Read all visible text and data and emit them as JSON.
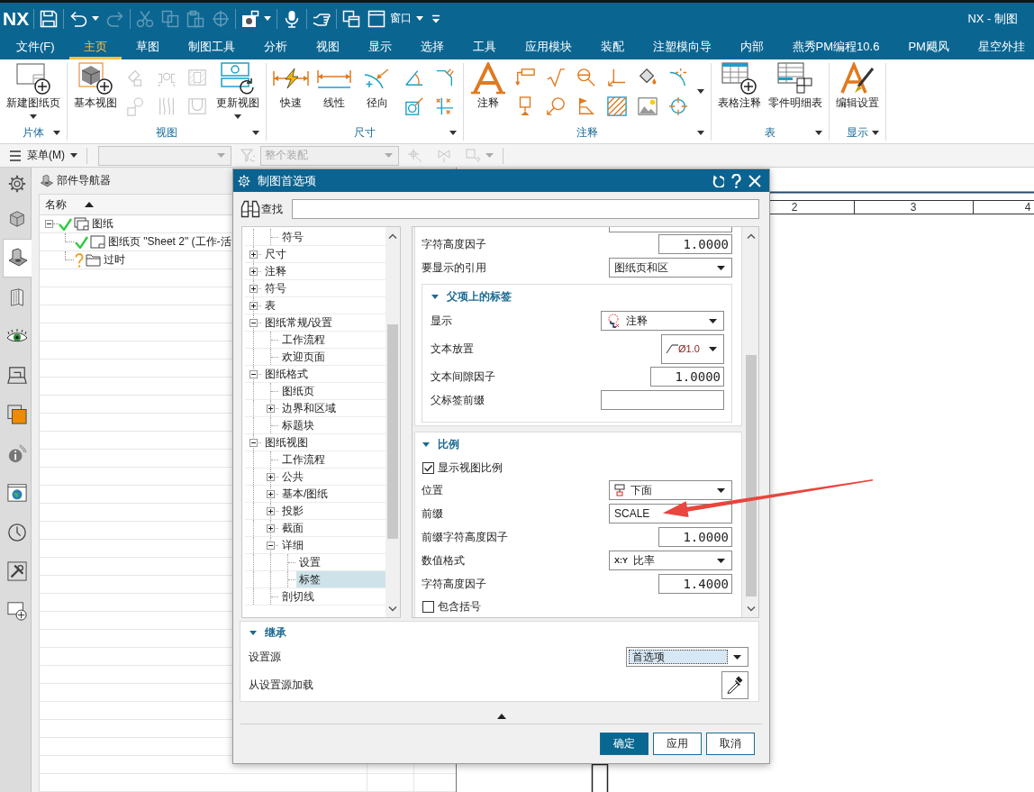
{
  "window": {
    "logo": "NX",
    "title": "NX - 制图"
  },
  "quick_access": [
    {
      "items": [
        {
          "kind": "save",
          "disabled": false,
          "has_menu": false
        }
      ]
    },
    {
      "items": [
        {
          "kind": "undo",
          "disabled": false,
          "has_menu": true
        },
        {
          "kind": "redo",
          "disabled": true,
          "has_menu": false
        }
      ]
    },
    {
      "items": [
        {
          "kind": "cut",
          "disabled": true,
          "has_menu": false
        },
        {
          "kind": "copy",
          "disabled": true,
          "has_menu": false
        },
        {
          "kind": "paste",
          "disabled": true,
          "has_menu": false
        },
        {
          "kind": "move",
          "disabled": true,
          "has_menu": false
        }
      ]
    },
    {
      "items": [
        {
          "kind": "camera",
          "disabled": false,
          "has_menu": true
        }
      ]
    },
    {
      "items": [
        {
          "kind": "microphone",
          "disabled": false,
          "has_menu": false
        }
      ]
    },
    {
      "items": [
        {
          "kind": "hand",
          "disabled": false,
          "has_menu": false
        }
      ]
    },
    {
      "items": [
        {
          "kind": "windows",
          "disabled": false,
          "has_menu": false
        },
        {
          "kind": "window",
          "label": "窗口",
          "disabled": false,
          "has_menu": true
        },
        {
          "kind": "customize",
          "disabled": false,
          "has_menu": false
        }
      ]
    }
  ],
  "menu_tabs": [
    {
      "label": "文件(F)",
      "selected": false
    },
    {
      "label": "主页",
      "selected": true
    },
    {
      "label": "草图",
      "selected": false
    },
    {
      "label": "制图工具",
      "selected": false
    },
    {
      "label": "分析",
      "selected": false
    },
    {
      "label": "视图",
      "selected": false
    },
    {
      "label": "显示",
      "selected": false
    },
    {
      "label": "选择",
      "selected": false
    },
    {
      "label": "工具",
      "selected": false
    },
    {
      "label": "应用模块",
      "selected": false
    },
    {
      "label": "装配",
      "selected": false
    },
    {
      "label": "注塑模向导",
      "selected": false
    },
    {
      "label": "内部",
      "selected": false
    },
    {
      "label": "燕秀PM编程10.6",
      "selected": false
    },
    {
      "label": "PM飓风",
      "selected": false
    },
    {
      "label": "星空外挂",
      "selected": false
    }
  ],
  "ribbon": {
    "groups": [
      {
        "label": "片体",
        "has_menu": true,
        "tools": [
          {
            "kind": "new_sheet",
            "label": "新建图纸页",
            "has_menu": true,
            "disabled": false
          }
        ]
      },
      {
        "label": "视图",
        "has_menu": true,
        "tools": [
          {
            "kind": "base_view",
            "label": "基本视图",
            "has_menu": false,
            "disabled": false
          },
          {
            "stack": [
              {
                "kind": "projected_view",
                "disabled": true
              },
              {
                "kind": "detail_view",
                "disabled": true
              }
            ]
          },
          {
            "stack": [
              {
                "kind": "section_view",
                "disabled": true
              },
              {
                "kind": "broken_view",
                "disabled": true
              }
            ]
          },
          {
            "stack": [
              {
                "kind": "view_break",
                "disabled": true
              },
              {
                "kind": "local_section",
                "disabled": true
              }
            ]
          },
          {
            "kind": "update_view",
            "label": "更新视图",
            "has_menu": true,
            "disabled": false
          }
        ]
      },
      {
        "label": "尺寸",
        "has_menu": true,
        "tools": [
          {
            "kind": "quick_dim",
            "label": "快速",
            "has_menu": false,
            "disabled": false
          },
          {
            "kind": "linear_dim",
            "label": "线性",
            "has_menu": false,
            "disabled": false
          },
          {
            "kind": "radial_dim",
            "label": "径向",
            "has_menu": false,
            "disabled": false
          },
          {
            "stack": [
              {
                "kind": "angular_dim",
                "disabled": false
              },
              {
                "kind": "hole_dim",
                "disabled": false
              }
            ]
          },
          {
            "stack": [
              {
                "kind": "chamfer_dim",
                "disabled": false
              },
              {
                "kind": "ordinate_dim",
                "disabled": false
              }
            ]
          }
        ]
      },
      {
        "label": "注释",
        "has_menu": true,
        "tools": [
          {
            "kind": "note",
            "label": "注释",
            "has_menu": false,
            "disabled": false
          },
          {
            "stack": [
              {
                "kind": "feature_frame",
                "disabled": false
              },
              {
                "kind": "datum",
                "disabled": false
              }
            ]
          },
          {
            "stack": [
              {
                "kind": "surface_finish",
                "disabled": false
              },
              {
                "kind": "balloon",
                "disabled": false
              }
            ]
          },
          {
            "stack": [
              {
                "kind": "weld",
                "disabled": false
              },
              {
                "kind": "flag",
                "disabled": false
              }
            ]
          },
          {
            "stack": [
              {
                "kind": "leader_corner",
                "disabled": false
              },
              {
                "kind": "hatch",
                "disabled": false
              }
            ]
          },
          {
            "stack": [
              {
                "kind": "area_fill",
                "disabled": false
              },
              {
                "kind": "image",
                "disabled": false
              }
            ]
          },
          {
            "stack": [
              {
                "kind": "center_mark",
                "disabled": false
              },
              {
                "kind": "bolt_circle",
                "disabled": false
              }
            ]
          },
          {
            "kind": "more"
          }
        ]
      },
      {
        "label": "表",
        "has_menu": true,
        "tools": [
          {
            "kind": "table_note",
            "label": "表格注释",
            "has_menu": false,
            "disabled": false
          },
          {
            "kind": "parts_list",
            "label": "零件明细表",
            "has_menu": false,
            "disabled": false
          }
        ]
      },
      {
        "label": "显示",
        "has_menu": true,
        "tools": [
          {
            "kind": "edit_settings",
            "label": "编辑设置",
            "has_menu": false,
            "disabled": false
          }
        ]
      }
    ]
  },
  "toolbar": {
    "menu_label": "菜单(M)",
    "type_filter": {
      "disabled": true
    },
    "filter": {
      "disabled": true
    },
    "scope": {
      "value": "整个装配",
      "disabled": true
    },
    "tools": [
      {
        "kind": "snap_point",
        "disabled": true,
        "has_menu": false
      },
      {
        "kind": "snap_set",
        "disabled": true,
        "has_menu": false
      },
      {
        "kind": "snap_box",
        "disabled": true,
        "has_menu": true
      }
    ]
  },
  "resource_bar": [
    {
      "kind": "settings",
      "selected": false
    },
    {
      "kind": "assembly",
      "selected": false
    },
    {
      "kind": "part_navigator",
      "selected": true
    },
    {
      "kind": "reuse_library",
      "selected": false
    },
    {
      "kind": "visualization",
      "selected": false
    },
    {
      "kind": "drafting",
      "selected": false
    },
    {
      "kind": "roles",
      "selected": false
    },
    {
      "kind": "info",
      "selected": false
    },
    {
      "kind": "web",
      "selected": false
    },
    {
      "kind": "history",
      "selected": false
    },
    {
      "kind": "tools",
      "selected": false
    },
    {
      "kind": "new",
      "selected": false
    }
  ],
  "part_navigator": {
    "title": "部件导航器",
    "columns": [
      {
        "label": "名称",
        "sorted": true
      }
    ],
    "rows": [
      {
        "kind": "drawing",
        "label": "图纸",
        "up_to_date": true,
        "expanded": true,
        "children": [
          {
            "kind": "sheet",
            "label": "图纸页 \"Sheet 2\" (工作-活",
            "up_to_date": true
          },
          {
            "kind": "folder",
            "label": "过时",
            "up_to_date": false
          }
        ]
      }
    ]
  },
  "drawing": {
    "zone_labels": [
      "2",
      "3",
      "4"
    ]
  },
  "dialog": {
    "title": "制图首选项",
    "search": {
      "label": "查找"
    },
    "tree": {
      "scrolled_parent_children": [
        {
          "label": "符号",
          "selected": false
        }
      ],
      "items": [
        {
          "label": "尺寸",
          "expanded": false,
          "selected": false
        },
        {
          "label": "注释",
          "expanded": false,
          "selected": false
        },
        {
          "label": "符号",
          "expanded": false,
          "selected": false
        },
        {
          "label": "表",
          "expanded": false,
          "selected": false
        },
        {
          "label": "图纸常规/设置",
          "expanded": true,
          "selected": false,
          "children": [
            {
              "label": "工作流程",
              "selected": false
            },
            {
              "label": "欢迎页面",
              "selected": false
            }
          ]
        },
        {
          "label": "图纸格式",
          "expanded": true,
          "selected": false,
          "children": [
            {
              "label": "图纸页",
              "selected": false
            },
            {
              "label": "边界和区域",
              "expanded": false,
              "selected": false
            },
            {
              "label": "标题块",
              "selected": false
            }
          ]
        },
        {
          "label": "图纸视图",
          "expanded": true,
          "selected": false,
          "children": [
            {
              "label": "工作流程",
              "selected": false
            },
            {
              "label": "公共",
              "expanded": false,
              "selected": false
            },
            {
              "label": "基本/图纸",
              "expanded": false,
              "selected": false
            },
            {
              "label": "投影",
              "expanded": false,
              "selected": false
            },
            {
              "label": "截面",
              "expanded": false,
              "selected": false
            },
            {
              "label": "详细",
              "expanded": true,
              "selected": false,
              "children": [
                {
                  "label": "设置",
                  "selected": false
                },
                {
                  "label": "标签",
                  "selected": true
                }
              ]
            },
            {
              "label": "剖切线",
              "selected": false
            }
          ]
        }
      ]
    },
    "settings": {
      "rows": [
        {
          "kind": "number",
          "label": "字符高度因子",
          "value": "1.0000"
        },
        {
          "kind": "dropdown",
          "label": "要显示的引用",
          "value": "图纸页和区"
        }
      ],
      "subgroups": [
        {
          "title": "父项上的标签",
          "expanded": true,
          "rows": [
            {
              "kind": "display_dropdown",
              "label": "显示",
              "value": "注释"
            },
            {
              "kind": "placement_dropdown",
              "label": "文本放置",
              "value": "Ø1.0"
            },
            {
              "kind": "number",
              "label": "文本间隙因子",
              "value": "1.0000"
            },
            {
              "kind": "text",
              "label": "父标签前缀"
            }
          ]
        }
      ]
    },
    "groups": [
      {
        "title": "比例",
        "expanded": true,
        "rows": [
          {
            "kind": "checkbox",
            "label": "显示视图比例",
            "checked": true
          },
          {
            "kind": "position_dropdown",
            "label": "位置",
            "value": "下面"
          },
          {
            "kind": "text",
            "label": "前缀",
            "value": "SCALE"
          },
          {
            "kind": "number",
            "label": "前缀字符高度因子",
            "value": "1.0000"
          },
          {
            "kind": "dropdown",
            "label": "数值格式",
            "value": "比率",
            "badge": "X:Y"
          },
          {
            "kind": "number",
            "label": "字符高度因子",
            "value": "1.4000"
          },
          {
            "kind": "checkbox",
            "label": "包含括号",
            "checked": false
          }
        ]
      }
    ],
    "inherit": {
      "title": "继承",
      "expanded": true,
      "rows": [
        {
          "kind": "dropdown",
          "label": "设置源",
          "value": "首选项",
          "focused": true
        },
        {
          "kind": "picker",
          "label": "从设置源加载"
        }
      ]
    },
    "buttons": [
      {
        "label": "确定",
        "kind": "primary"
      },
      {
        "label": "应用",
        "kind": "normal"
      },
      {
        "label": "取消",
        "kind": "normal"
      }
    ]
  }
}
